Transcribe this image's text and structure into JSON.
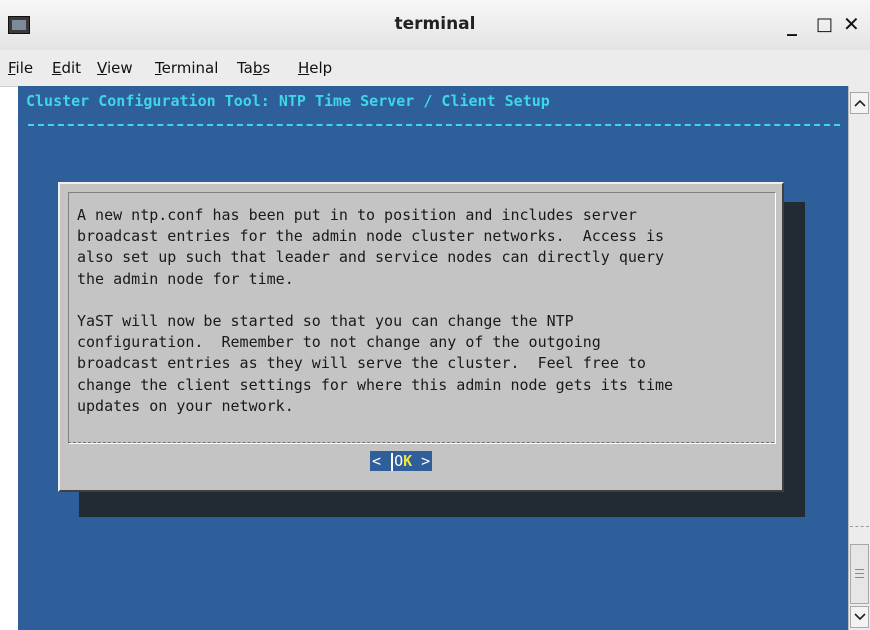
{
  "window": {
    "title": "terminal",
    "controls": {
      "minimize": "_",
      "maximize": "□",
      "close": "✕"
    },
    "app_icon": "terminal-icon"
  },
  "menubar": {
    "items": [
      {
        "accel": "F",
        "rest": "ile"
      },
      {
        "accel": "E",
        "rest": "dit"
      },
      {
        "accel": "V",
        "rest": "iew"
      },
      {
        "accel": "T",
        "rest": "erminal"
      },
      {
        "pre": "Ta",
        "accel": "b",
        "rest": "s"
      },
      {
        "accel": "H",
        "rest": "elp"
      }
    ]
  },
  "terminal": {
    "heading": "Cluster Configuration Tool: NTP Time Server / Client Setup",
    "colors": {
      "background": "#2e5f9a",
      "heading": "#3fd7e6",
      "dialog": "#c4c4c4",
      "button_hotkey": "#f4e23c"
    }
  },
  "dialog": {
    "message": "A new ntp.conf has been put in to position and includes server\nbroadcast entries for the admin node cluster networks.  Access is\nalso set up such that leader and service nodes can directly query\nthe admin node for time.\n\nYaST will now be started so that you can change the NTP\nconfiguration.  Remember to not change any of the outgoing\nbroadcast entries as they will serve the cluster.  Feel free to\nchange the client settings for where this admin node gets its time\nupdates on your network.",
    "ok_button": {
      "left": "< ",
      "first": "O",
      "hot": "K",
      "right": " >"
    }
  },
  "scrollbar": {
    "up_icon": "chevron-up-icon",
    "down_icon": "chevron-down-icon"
  }
}
